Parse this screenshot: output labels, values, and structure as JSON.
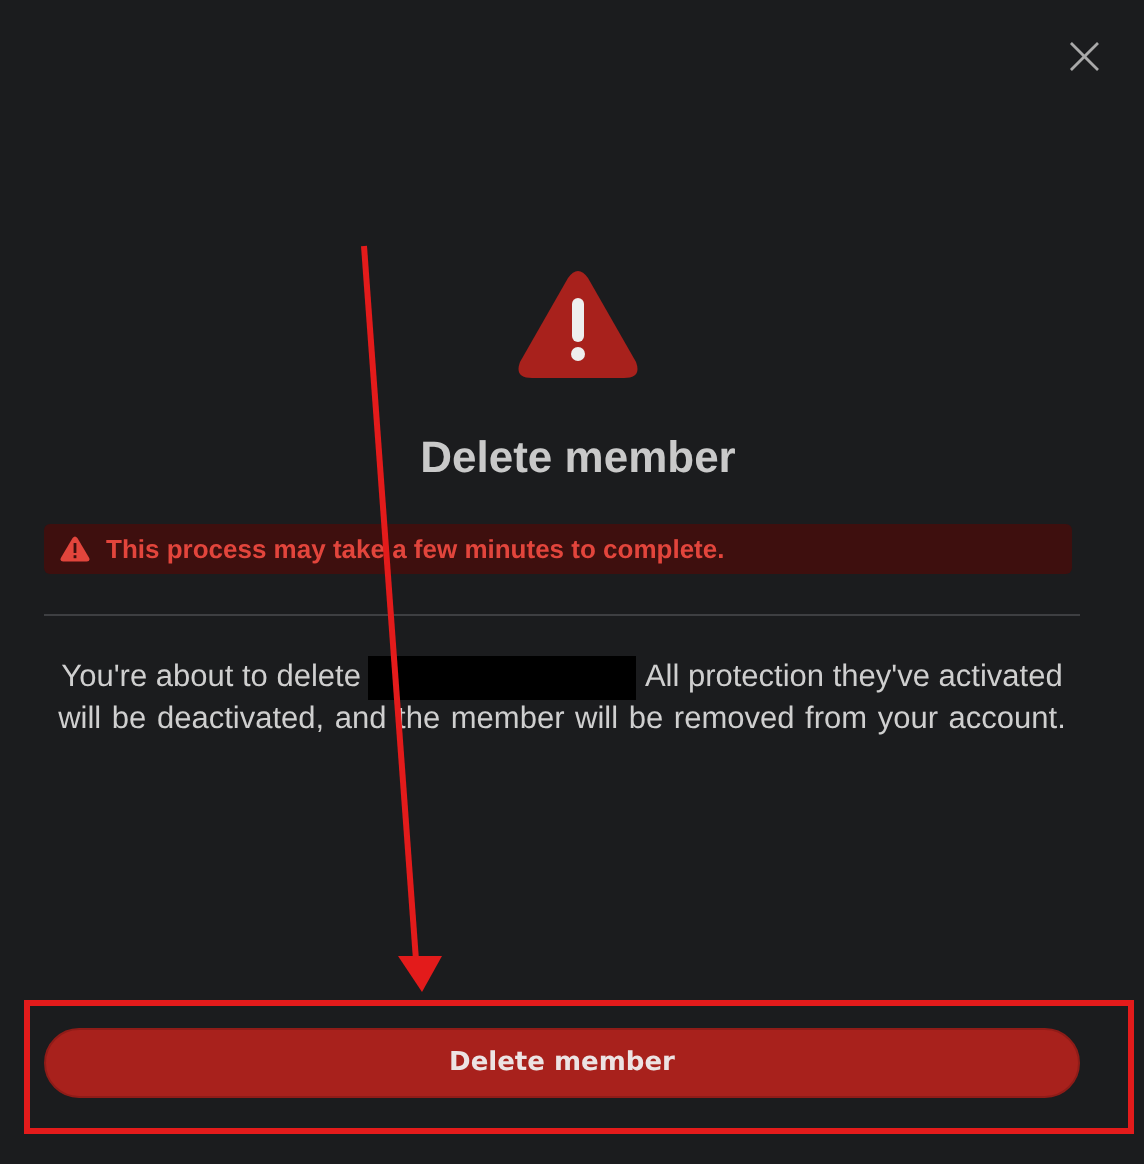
{
  "dialog": {
    "close_label": "×",
    "title": "Delete member",
    "alert": {
      "kind": "error",
      "text": "This process may take a few minutes to complete."
    },
    "message": {
      "before": "You're about to delete",
      "redacted": true,
      "after_line_1": "All protection they've activated",
      "after_line_2": "will be deactivated, and the member will be removed from your account."
    },
    "button": {
      "label": "Delete member"
    }
  },
  "annotations": {
    "arrow": true,
    "highlight_box": true
  }
}
